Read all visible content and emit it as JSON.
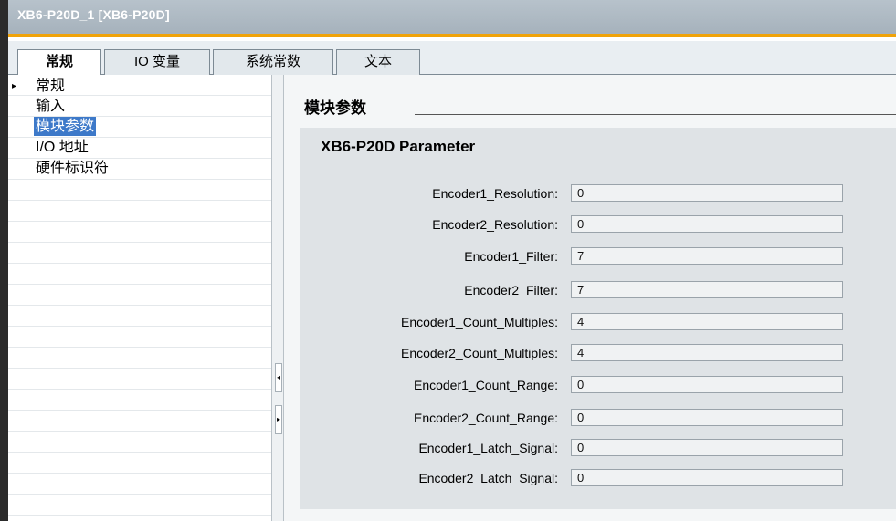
{
  "window": {
    "title": "XB6-P20D_1 [XB6-P20D]"
  },
  "tabs": [
    {
      "label": "常规",
      "active": true
    },
    {
      "label": "IO 变量",
      "active": false
    },
    {
      "label": "系统常数",
      "active": false
    },
    {
      "label": "文本",
      "active": false
    }
  ],
  "sidebar": {
    "items": [
      {
        "label": "常规",
        "expander": "▸"
      },
      {
        "label": "输入"
      },
      {
        "label": "模块参数",
        "selected": true
      },
      {
        "label": "I/O 地址"
      },
      {
        "label": "硬件标识符"
      }
    ]
  },
  "splitter": {
    "collapse_icon": "◂",
    "expand_icon": "▸"
  },
  "main": {
    "section_title": "模块参数",
    "panel_title": "XB6-P20D Parameter",
    "params": [
      {
        "label": "Encoder1_Resolution:",
        "value": "0"
      },
      {
        "label": "Encoder2_Resolution:",
        "value": "0"
      },
      {
        "label": "Encoder1_Filter:",
        "value": "7"
      },
      {
        "label": "Encoder2_Filter:",
        "value": "7"
      },
      {
        "label": "Encoder1_Count_Multiples:",
        "value": "4"
      },
      {
        "label": "Encoder2_Count_Multiples:",
        "value": "4"
      },
      {
        "label": "Encoder1_Count_Range:",
        "value": "0"
      },
      {
        "label": "Encoder2_Count_Range:",
        "value": "0"
      },
      {
        "label": "Encoder1_Latch_Signal:",
        "value": "0"
      },
      {
        "label": "Encoder2_Latch_Signal:",
        "value": "0"
      }
    ]
  },
  "colors": {
    "accent_orange": "#f0a30a",
    "selection_blue": "#3d79c9",
    "titlebar": "#a6b2bc"
  }
}
